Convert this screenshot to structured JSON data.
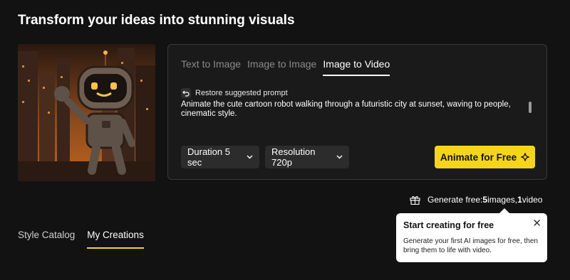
{
  "header": {
    "title": "Transform your ideas into stunning visuals"
  },
  "panel": {
    "tabs": [
      {
        "label": "Text to Image",
        "active": false
      },
      {
        "label": "Image to Image",
        "active": false
      },
      {
        "label": "Image to Video",
        "active": true
      }
    ],
    "restore_label": "Restore suggested prompt",
    "prompt_text": "Animate the cute cartoon robot walking through a futuristic city at sunset, waving to people, cinematic style.",
    "duration_label": "Duration 5 sec",
    "resolution_label": "Resolution 720p",
    "animate_label": "Animate for Free"
  },
  "generate_free": {
    "prefix": "Generate free: ",
    "images_count": "5",
    "images_word": " images, ",
    "video_count": "1",
    "video_word": " video"
  },
  "lower_tabs": [
    {
      "label": "Style Catalog",
      "active": false
    },
    {
      "label": "My Creations",
      "active": true
    }
  ],
  "tooltip": {
    "title": "Start creating for free",
    "close": "✕",
    "body": "Generate your first AI images for free, then bring them to life with video."
  },
  "colors": {
    "accent": "#f5d51c",
    "background": "#121212",
    "panel": "#1a1a1a",
    "select_bg": "#2c2c2c"
  },
  "icons": [
    "undo-icon",
    "chevron-down-icon",
    "sparkle-icon",
    "gift-icon",
    "close-icon"
  ]
}
